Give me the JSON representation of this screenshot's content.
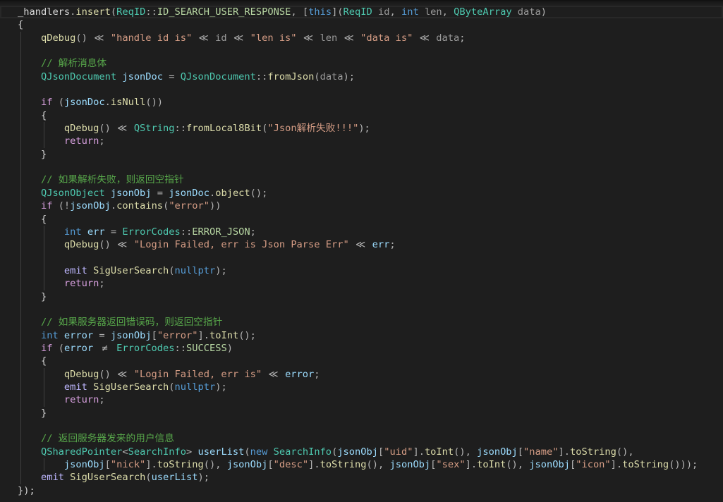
{
  "editor": {
    "theme": {
      "background": "#1e1e1e",
      "indent_guide": "#404040",
      "current_line_border": "#282828"
    },
    "lines": [
      [
        [
          "_handlers",
          "#dadada"
        ],
        [
          ".",
          "#b4b4b4"
        ],
        [
          "insert",
          "#dcdcaa"
        ],
        [
          "(",
          "#b4b4b4"
        ],
        [
          "ReqID",
          "#4ec9b0"
        ],
        [
          "::",
          "#b4b4b4"
        ],
        [
          "ID_SEARCH_USER_RESPONSE",
          "#b8d7a3"
        ],
        [
          ", [",
          "#b4b4b4"
        ],
        [
          "this",
          "#569cd6"
        ],
        [
          "](",
          "#b4b4b4"
        ],
        [
          "ReqID",
          "#4ec9b0"
        ],
        [
          " id",
          "#9a9a9a"
        ],
        [
          ", ",
          "#b4b4b4"
        ],
        [
          "int",
          "#569cd6"
        ],
        [
          " len",
          "#9a9a9a"
        ],
        [
          ", ",
          "#b4b4b4"
        ],
        [
          "QByteArray",
          "#4ec9b0"
        ],
        [
          " data",
          "#9a9a9a"
        ],
        [
          ")",
          "#b4b4b4"
        ]
      ],
      [
        [
          "{",
          "#d4d4d4"
        ]
      ],
      [
        [
          "    qDebug",
          "#dcdcaa"
        ],
        [
          "() ",
          "#b4b4b4"
        ],
        [
          "≪",
          "#b4b4b4"
        ],
        [
          " \"handle id is\" ",
          "#d69d85"
        ],
        [
          "≪",
          "#b4b4b4"
        ],
        [
          " id ",
          "#9a9a9a"
        ],
        [
          "≪",
          "#b4b4b4"
        ],
        [
          " \"len is\" ",
          "#d69d85"
        ],
        [
          "≪",
          "#b4b4b4"
        ],
        [
          " len ",
          "#9a9a9a"
        ],
        [
          "≪",
          "#b4b4b4"
        ],
        [
          " \"data is\" ",
          "#d69d85"
        ],
        [
          "≪",
          "#b4b4b4"
        ],
        [
          " data",
          "#9a9a9a"
        ],
        [
          ";",
          "#b4b4b4"
        ]
      ],
      [],
      [
        [
          "    // 解析消息体",
          "#57a64a"
        ]
      ],
      [
        [
          "    QJsonDocument",
          "#4ec9b0"
        ],
        [
          " jsonDoc",
          "#9cdcfe"
        ],
        [
          " = ",
          "#b4b4b4"
        ],
        [
          "QJsonDocument",
          "#4ec9b0"
        ],
        [
          "::",
          "#b4b4b4"
        ],
        [
          "fromJson",
          "#dcdcaa"
        ],
        [
          "(",
          "#b4b4b4"
        ],
        [
          "data",
          "#9a9a9a"
        ],
        [
          ");",
          "#b4b4b4"
        ]
      ],
      [],
      [
        [
          "    if",
          "#d8a0df"
        ],
        [
          " (",
          "#b4b4b4"
        ],
        [
          "jsonDoc",
          "#9cdcfe"
        ],
        [
          ".",
          "#b4b4b4"
        ],
        [
          "isNull",
          "#dcdcaa"
        ],
        [
          "())",
          "#b4b4b4"
        ]
      ],
      [
        [
          "    {",
          "#d4d4d4"
        ]
      ],
      [
        [
          "        qDebug",
          "#dcdcaa"
        ],
        [
          "() ",
          "#b4b4b4"
        ],
        [
          "≪",
          "#b4b4b4"
        ],
        [
          " QString",
          "#4ec9b0"
        ],
        [
          "::",
          "#b4b4b4"
        ],
        [
          "fromLocal8Bit",
          "#dcdcaa"
        ],
        [
          "(",
          "#b4b4b4"
        ],
        [
          "\"Json解析失败!!!\"",
          "#d69d85"
        ],
        [
          ");",
          "#b4b4b4"
        ]
      ],
      [
        [
          "        return",
          "#d8a0df"
        ],
        [
          ";",
          "#b4b4b4"
        ]
      ],
      [
        [
          "    }",
          "#d4d4d4"
        ]
      ],
      [],
      [
        [
          "    // 如果解析失败，则返回空指针",
          "#57a64a"
        ]
      ],
      [
        [
          "    QJsonObject",
          "#4ec9b0"
        ],
        [
          " jsonObj",
          "#9cdcfe"
        ],
        [
          " = ",
          "#b4b4b4"
        ],
        [
          "jsonDoc",
          "#9cdcfe"
        ],
        [
          ".",
          "#b4b4b4"
        ],
        [
          "object",
          "#dcdcaa"
        ],
        [
          "();",
          "#b4b4b4"
        ]
      ],
      [
        [
          "    if",
          "#d8a0df"
        ],
        [
          " (!",
          "#b4b4b4"
        ],
        [
          "jsonObj",
          "#9cdcfe"
        ],
        [
          ".",
          "#b4b4b4"
        ],
        [
          "contains",
          "#dcdcaa"
        ],
        [
          "(",
          "#b4b4b4"
        ],
        [
          "\"error\"",
          "#d69d85"
        ],
        [
          "))",
          "#b4b4b4"
        ]
      ],
      [
        [
          "    {",
          "#d4d4d4"
        ]
      ],
      [
        [
          "        int",
          "#569cd6"
        ],
        [
          " err",
          "#9cdcfe"
        ],
        [
          " = ",
          "#b4b4b4"
        ],
        [
          "ErrorCodes",
          "#4ec9b0"
        ],
        [
          "::",
          "#b4b4b4"
        ],
        [
          "ERROR_JSON",
          "#b8d7a3"
        ],
        [
          ";",
          "#b4b4b4"
        ]
      ],
      [
        [
          "        qDebug",
          "#dcdcaa"
        ],
        [
          "() ",
          "#b4b4b4"
        ],
        [
          "≪",
          "#b4b4b4"
        ],
        [
          " \"Login Failed, err is Json Parse Err\" ",
          "#d69d85"
        ],
        [
          "≪",
          "#b4b4b4"
        ],
        [
          " err",
          "#9cdcfe"
        ],
        [
          ";",
          "#b4b4b4"
        ]
      ],
      [],
      [
        [
          "        emit",
          "#beb7ff"
        ],
        [
          " SigUserSearch",
          "#dcdcaa"
        ],
        [
          "(",
          "#b4b4b4"
        ],
        [
          "nullptr",
          "#569cd6"
        ],
        [
          ");",
          "#b4b4b4"
        ]
      ],
      [
        [
          "        return",
          "#d8a0df"
        ],
        [
          ";",
          "#b4b4b4"
        ]
      ],
      [
        [
          "    }",
          "#d4d4d4"
        ]
      ],
      [],
      [
        [
          "    // 如果服务器返回错误码，则返回空指针",
          "#57a64a"
        ]
      ],
      [
        [
          "    int",
          "#569cd6"
        ],
        [
          " error",
          "#9cdcfe"
        ],
        [
          " = ",
          "#b4b4b4"
        ],
        [
          "jsonObj",
          "#9cdcfe"
        ],
        [
          "[",
          "#b4b4b4"
        ],
        [
          "\"error\"",
          "#d69d85"
        ],
        [
          "].",
          "#b4b4b4"
        ],
        [
          "toInt",
          "#dcdcaa"
        ],
        [
          "();",
          "#b4b4b4"
        ]
      ],
      [
        [
          "    if",
          "#d8a0df"
        ],
        [
          " (",
          "#b4b4b4"
        ],
        [
          "error ",
          "#9cdcfe"
        ],
        [
          "≠",
          "#b4b4b4"
        ],
        [
          " ErrorCodes",
          "#4ec9b0"
        ],
        [
          "::",
          "#b4b4b4"
        ],
        [
          "SUCCESS",
          "#b8d7a3"
        ],
        [
          ")",
          "#b4b4b4"
        ]
      ],
      [
        [
          "    {",
          "#d4d4d4"
        ]
      ],
      [
        [
          "        qDebug",
          "#dcdcaa"
        ],
        [
          "() ",
          "#b4b4b4"
        ],
        [
          "≪",
          "#b4b4b4"
        ],
        [
          " \"Login Failed, err is\" ",
          "#d69d85"
        ],
        [
          "≪",
          "#b4b4b4"
        ],
        [
          " error",
          "#9cdcfe"
        ],
        [
          ";",
          "#b4b4b4"
        ]
      ],
      [
        [
          "        emit",
          "#beb7ff"
        ],
        [
          " SigUserSearch",
          "#dcdcaa"
        ],
        [
          "(",
          "#b4b4b4"
        ],
        [
          "nullptr",
          "#569cd6"
        ],
        [
          ");",
          "#b4b4b4"
        ]
      ],
      [
        [
          "        return",
          "#d8a0df"
        ],
        [
          ";",
          "#b4b4b4"
        ]
      ],
      [
        [
          "    }",
          "#d4d4d4"
        ]
      ],
      [],
      [
        [
          "    // 返回服务器发来的用户信息",
          "#57a64a"
        ]
      ],
      [
        [
          "    QSharedPointer",
          "#4ec9b0"
        ],
        [
          "<",
          "#b4b4b4"
        ],
        [
          "SearchInfo",
          "#4ec9b0"
        ],
        [
          "> ",
          "#b4b4b4"
        ],
        [
          "userList",
          "#9cdcfe"
        ],
        [
          "(",
          "#b4b4b4"
        ],
        [
          "new",
          "#569cd6"
        ],
        [
          " SearchInfo",
          "#4ec9b0"
        ],
        [
          "(",
          "#b4b4b4"
        ],
        [
          "jsonObj",
          "#9cdcfe"
        ],
        [
          "[",
          "#b4b4b4"
        ],
        [
          "\"uid\"",
          "#d69d85"
        ],
        [
          "].",
          "#b4b4b4"
        ],
        [
          "toInt",
          "#dcdcaa"
        ],
        [
          "(), ",
          "#b4b4b4"
        ],
        [
          "jsonObj",
          "#9cdcfe"
        ],
        [
          "[",
          "#b4b4b4"
        ],
        [
          "\"name\"",
          "#d69d85"
        ],
        [
          "].",
          "#b4b4b4"
        ],
        [
          "toString",
          "#dcdcaa"
        ],
        [
          "(),",
          "#b4b4b4"
        ]
      ],
      [
        [
          "        jsonObj",
          "#9cdcfe"
        ],
        [
          "[",
          "#b4b4b4"
        ],
        [
          "\"nick\"",
          "#d69d85"
        ],
        [
          "].",
          "#b4b4b4"
        ],
        [
          "toString",
          "#dcdcaa"
        ],
        [
          "(), ",
          "#b4b4b4"
        ],
        [
          "jsonObj",
          "#9cdcfe"
        ],
        [
          "[",
          "#b4b4b4"
        ],
        [
          "\"desc\"",
          "#d69d85"
        ],
        [
          "].",
          "#b4b4b4"
        ],
        [
          "toString",
          "#dcdcaa"
        ],
        [
          "(), ",
          "#b4b4b4"
        ],
        [
          "jsonObj",
          "#9cdcfe"
        ],
        [
          "[",
          "#b4b4b4"
        ],
        [
          "\"sex\"",
          "#d69d85"
        ],
        [
          "].",
          "#b4b4b4"
        ],
        [
          "toInt",
          "#dcdcaa"
        ],
        [
          "(), ",
          "#b4b4b4"
        ],
        [
          "jsonObj",
          "#9cdcfe"
        ],
        [
          "[",
          "#b4b4b4"
        ],
        [
          "\"icon\"",
          "#d69d85"
        ],
        [
          "].",
          "#b4b4b4"
        ],
        [
          "toString",
          "#dcdcaa"
        ],
        [
          "()));",
          "#b4b4b4"
        ]
      ],
      [
        [
          "    emit",
          "#beb7ff"
        ],
        [
          " SigUserSearch",
          "#dcdcaa"
        ],
        [
          "(",
          "#b4b4b4"
        ],
        [
          "userList",
          "#9cdcfe"
        ],
        [
          ");",
          "#b4b4b4"
        ]
      ],
      [
        [
          "});",
          "#d4d4d4"
        ]
      ]
    ]
  }
}
